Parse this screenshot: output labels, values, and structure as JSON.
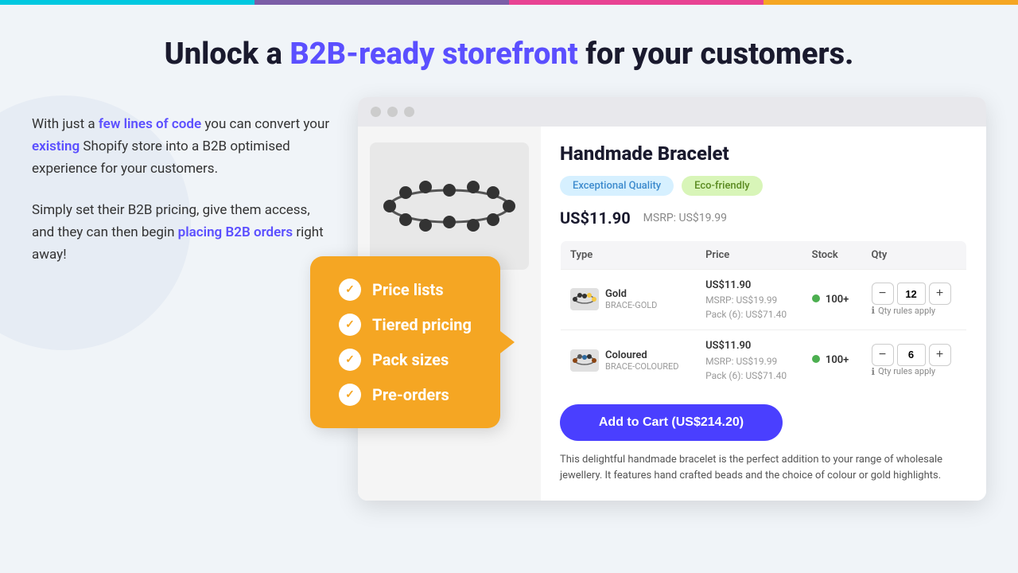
{
  "topbar": {
    "segments": [
      "cyan",
      "purple",
      "pink",
      "orange"
    ]
  },
  "hero": {
    "title_prefix": "Unlock a ",
    "title_highlight": "B2B-ready storefront",
    "title_suffix": " for your customers."
  },
  "left_panel": {
    "paragraph1_prefix": "With just a ",
    "paragraph1_link1": "few lines of code",
    "paragraph1_middle": " you can convert your ",
    "paragraph1_link2": "existing",
    "paragraph1_suffix": " Shopify store into a B2B optimised experience for your customers.",
    "paragraph2_prefix": "Simply set their B2B pricing, give them access, and they can then begin ",
    "paragraph2_link": "placing B2B orders",
    "paragraph2_suffix": " right away!"
  },
  "feature_box": {
    "items": [
      {
        "label": "Price lists"
      },
      {
        "label": "Tiered pricing"
      },
      {
        "label": "Pack sizes"
      },
      {
        "label": "Pre-orders"
      }
    ]
  },
  "browser": {
    "dots": [
      "grey",
      "grey",
      "grey"
    ]
  },
  "product": {
    "title": "Handmade Bracelet",
    "tags": [
      {
        "label": "Exceptional Quality",
        "style": "blue"
      },
      {
        "label": "Eco-friendly",
        "style": "green"
      }
    ],
    "price": "US$11.90",
    "msrp": "MSRP: US$19.99",
    "table": {
      "headers": [
        "Type",
        "Price",
        "Stock",
        "Qty"
      ],
      "rows": [
        {
          "type_name": "Gold",
          "type_sku": "BRACE-GOLD",
          "price": "US$11.90",
          "price_msrp": "MSRP: US$19.99",
          "price_pack": "Pack (6): US$71.40",
          "stock": "100+",
          "qty": "12"
        },
        {
          "type_name": "Coloured",
          "type_sku": "BRACE-COLOURED",
          "price": "US$11.90",
          "price_msrp": "MSRP: US$19.99",
          "price_pack": "Pack (6): US$71.40",
          "stock": "100+",
          "qty": "6"
        }
      ]
    },
    "qty_rules": "Qty rules apply",
    "add_to_cart": "Add to Cart (US$214.20)",
    "description": "This delightful handmade bracelet is the perfect addition to your range of wholesale jewellery. It features hand crafted beads and the choice of colour or gold highlights."
  }
}
